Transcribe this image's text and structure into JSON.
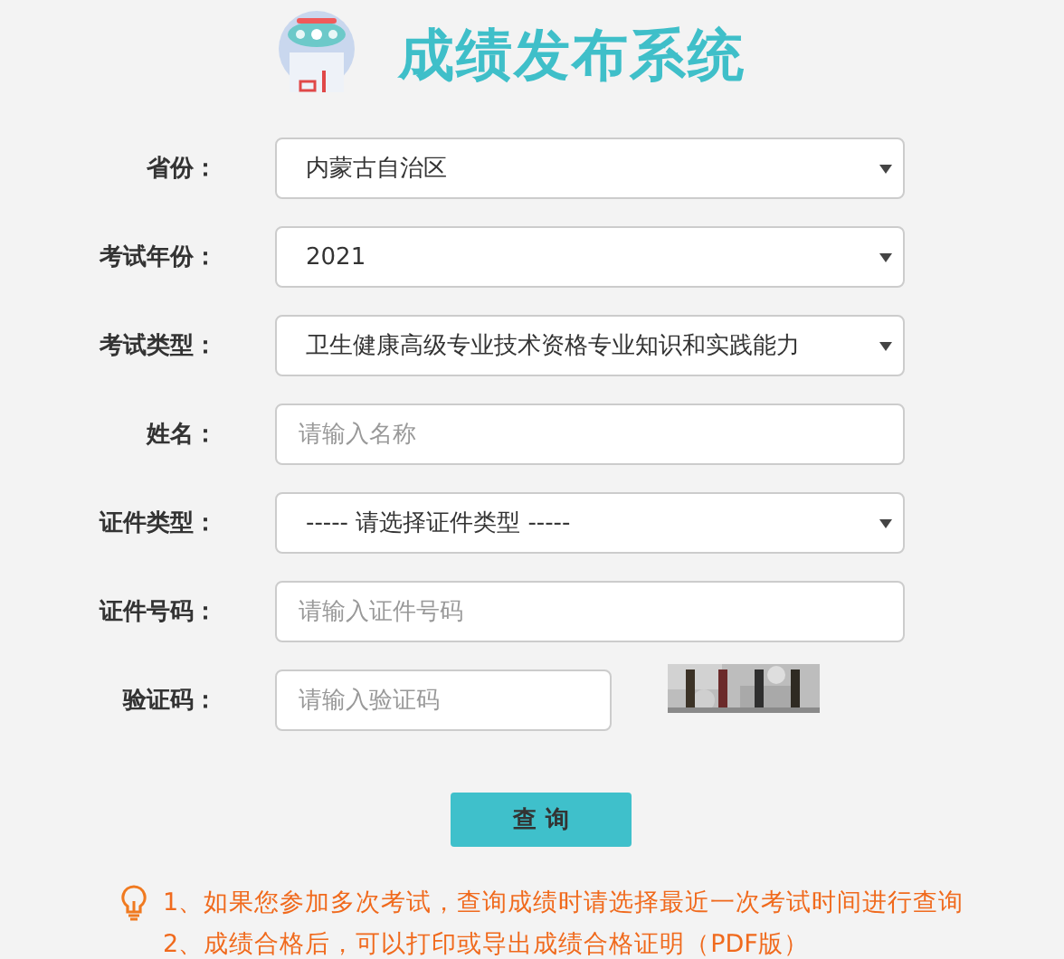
{
  "header": {
    "title": "成绩发布系统"
  },
  "fields": [
    {
      "kind": "select",
      "label": "省份：",
      "value": "内蒙古自治区"
    },
    {
      "kind": "select",
      "label": "考试年份：",
      "value": "2021"
    },
    {
      "kind": "select",
      "label": "考试类型：",
      "value": "卫生健康高级专业技术资格专业知识和实践能力"
    },
    {
      "kind": "input",
      "label": "姓名：",
      "placeholder": "请输入名称"
    },
    {
      "kind": "select",
      "label": "证件类型：",
      "value": "----- 请选择证件类型 -----"
    },
    {
      "kind": "input",
      "label": "证件号码：",
      "placeholder": "请输入证件号码"
    },
    {
      "kind": "captcha",
      "label": "验证码：",
      "placeholder": "请输入验证码"
    }
  ],
  "submit": {
    "label": "查 询"
  },
  "notes": [
    "1、如果您参加多次考试，查询成绩时请选择最近一次考试时间进行查询",
    "2、成绩合格后，可以打印或导出成绩合格证明（PDF版）"
  ]
}
